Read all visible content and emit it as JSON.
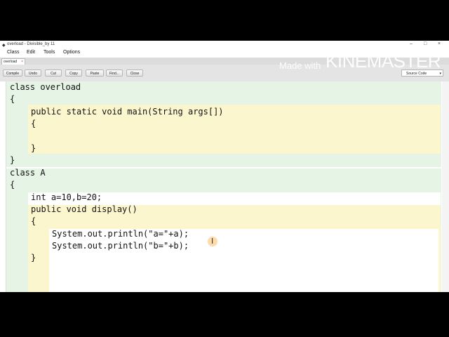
{
  "window": {
    "title": "overload - Divisible_by 11",
    "controls": [
      "–",
      "□",
      "×"
    ]
  },
  "menu": [
    "Class",
    "Edit",
    "Tools",
    "Options"
  ],
  "tab": {
    "label": "overload"
  },
  "toolbar": {
    "buttons": [
      "Compile",
      "Undo",
      "Cut",
      "Copy",
      "Paste",
      "Find...",
      "Close"
    ],
    "view_select": "Source Code"
  },
  "watermark": {
    "made_with": "Made with",
    "brand": "KINEMASTER"
  },
  "code_lines": [
    "class overload",
    "{",
    "public static void main(String args[])",
    "{",
    "}",
    "}",
    "class A",
    "{",
    "int a=10,b=20;",
    "public void display()",
    "{",
    "System.out.println(\"a=\"+a);",
    "System.out.println(\"b=\"+b);",
    "}"
  ],
  "cursor_glyph": "I",
  "status": {
    "saved": "saved"
  },
  "colors": {
    "class_scope": "#e5f4e5",
    "method_scope": "#fbf6cd",
    "inner_scope": "#ffffff",
    "screen_bg": "#000000"
  }
}
